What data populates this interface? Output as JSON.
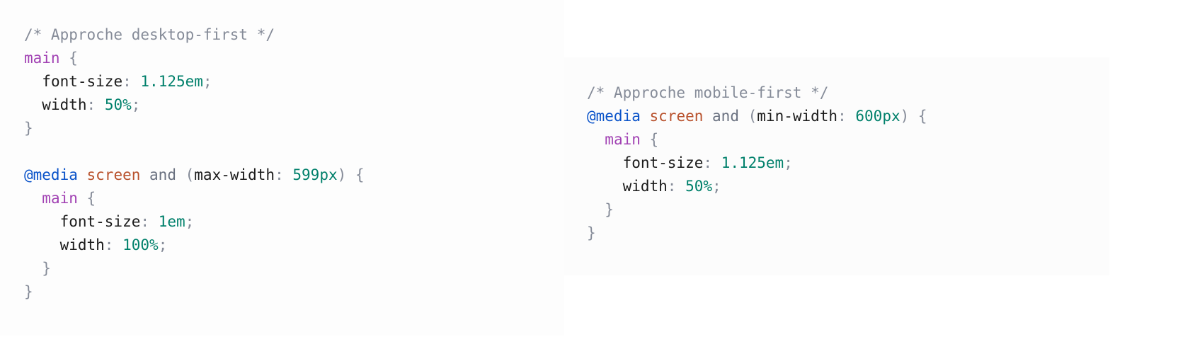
{
  "colors": {
    "background": "#ffffff",
    "panel": "#fdfdfd",
    "comment": "#858b98",
    "selector": "#a141b3",
    "punctuation": "#858b98",
    "property": "#1b1b1b",
    "value": "#00806b",
    "at_rule": "#0a53c9",
    "media_type": "#b8512c"
  },
  "desktop_first": {
    "comment": "/* Approche desktop-first */",
    "rule1_selector": "main",
    "rule1_props": [
      {
        "prop": "font-size",
        "value": "1.125em"
      },
      {
        "prop": "width",
        "value": "50%"
      }
    ],
    "media_at": "@media",
    "media_type": "screen",
    "media_and": "and",
    "media_feature": "max-width",
    "media_value": "599px",
    "rule2_selector": "main",
    "rule2_props": [
      {
        "prop": "font-size",
        "value": "1em"
      },
      {
        "prop": "width",
        "value": "100%"
      }
    ]
  },
  "mobile_first": {
    "comment": "/* Approche mobile-first */",
    "media_at": "@media",
    "media_type": "screen",
    "media_and": "and",
    "media_feature": "min-width",
    "media_value": "600px",
    "rule_selector": "main",
    "rule_props": [
      {
        "prop": "font-size",
        "value": "1.125em"
      },
      {
        "prop": "width",
        "value": "50%"
      }
    ]
  }
}
